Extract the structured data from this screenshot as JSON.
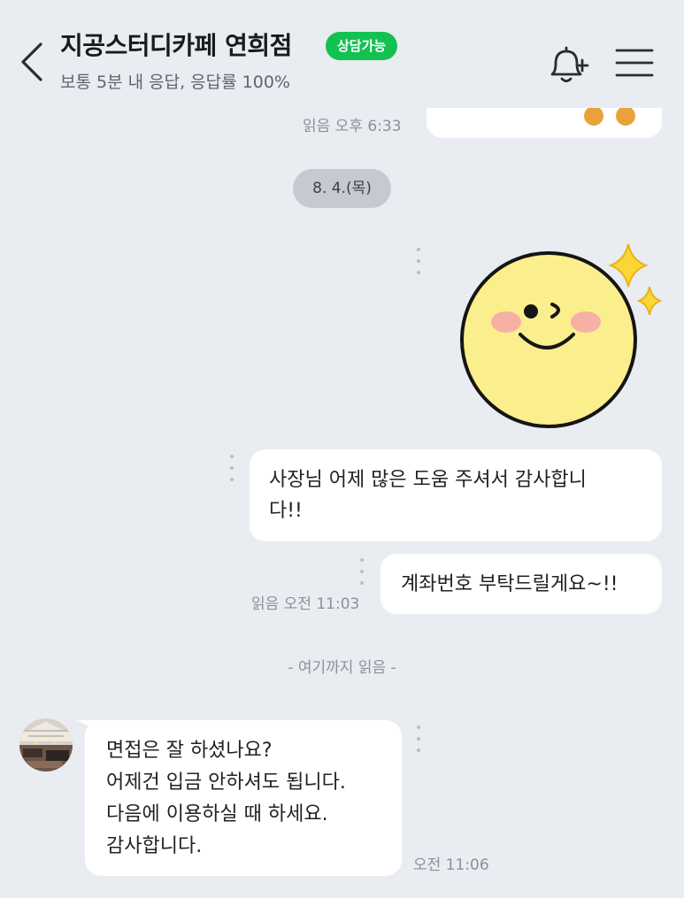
{
  "header": {
    "back_icon": "chevron-left-icon",
    "title": "지공스터디카페 연희점",
    "badge": "상담가능",
    "subtitle": "보통 5분 내 응답, 응답률 100%",
    "bell_icon": "bell-plus-icon",
    "menu_icon": "hamburger-menu-icon",
    "badge_color": "#13c152"
  },
  "chat": {
    "previous": {
      "read_time": "읽음 오후 6:33"
    },
    "date_divider": "8. 4.(목)",
    "sticker": {
      "name": "winking-smiley-sticker",
      "color": "#fbee8c"
    },
    "messages_sent": [
      {
        "text": "사장님 어제 많은 도움 주셔서 감사합니\n다!!"
      },
      {
        "text": "계좌번호 부탁드릴게요~!!"
      }
    ],
    "read_time": "읽음 오전 11:03",
    "read_divider": "- 여기까지 읽음 -",
    "received": {
      "avatar": "cafe-profile-avatar",
      "text": "면접은 잘 하셨나요?\n어제건 입금 안하셔도 됩니다.\n다음에 이용하실 때 하세요.\n감사합니다.",
      "time": "오전 11:06"
    }
  },
  "colors": {
    "background": "#e9ecf1",
    "bubble": "#ffffff",
    "date_chip": "#c5cad2",
    "meta_text": "#8c9199"
  }
}
